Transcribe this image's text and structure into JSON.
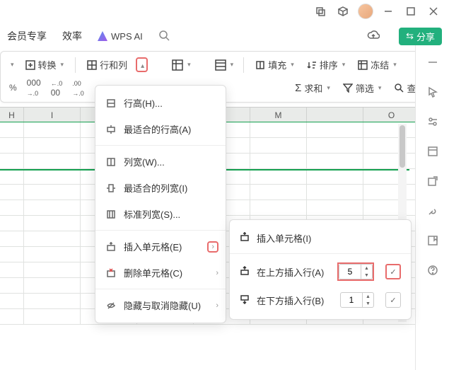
{
  "titlebar": {
    "window_controls": [
      "restore",
      "cube",
      "avatar",
      "minimize",
      "maximize",
      "close"
    ]
  },
  "tabs": {
    "member": "会员专享",
    "efficiency": "效率",
    "wps_ai": "WPS AI",
    "share": "分享"
  },
  "ribbon": {
    "convert": "转换",
    "rows_cols": "行和列",
    "fill": "填充",
    "sort": "排序",
    "freeze": "冻结",
    "sum": "求和",
    "filter": "筛选",
    "find": "查找",
    "row2": {
      "percent": "%",
      "inc": "000",
      "dec": "0",
      "dec2": "00"
    }
  },
  "columns": [
    "H",
    "I",
    "",
    "",
    "",
    "M",
    "",
    "O"
  ],
  "menu1": {
    "row_height": "行高(H)...",
    "autofit_row": "最适合的行高(A)",
    "col_width": "列宽(W)...",
    "autofit_col": "最适合的列宽(I)",
    "std_width": "标准列宽(S)...",
    "insert_cells": "插入单元格(E)",
    "delete_cells": "删除单元格(C)",
    "hide_unhide": "隐藏与取消隐藏(U)"
  },
  "menu2": {
    "insert_cells": "插入单元格(I)",
    "insert_above": "在上方插入行(A)",
    "insert_below": "在下方插入行(B)",
    "above_val": "5",
    "below_val": "1"
  }
}
